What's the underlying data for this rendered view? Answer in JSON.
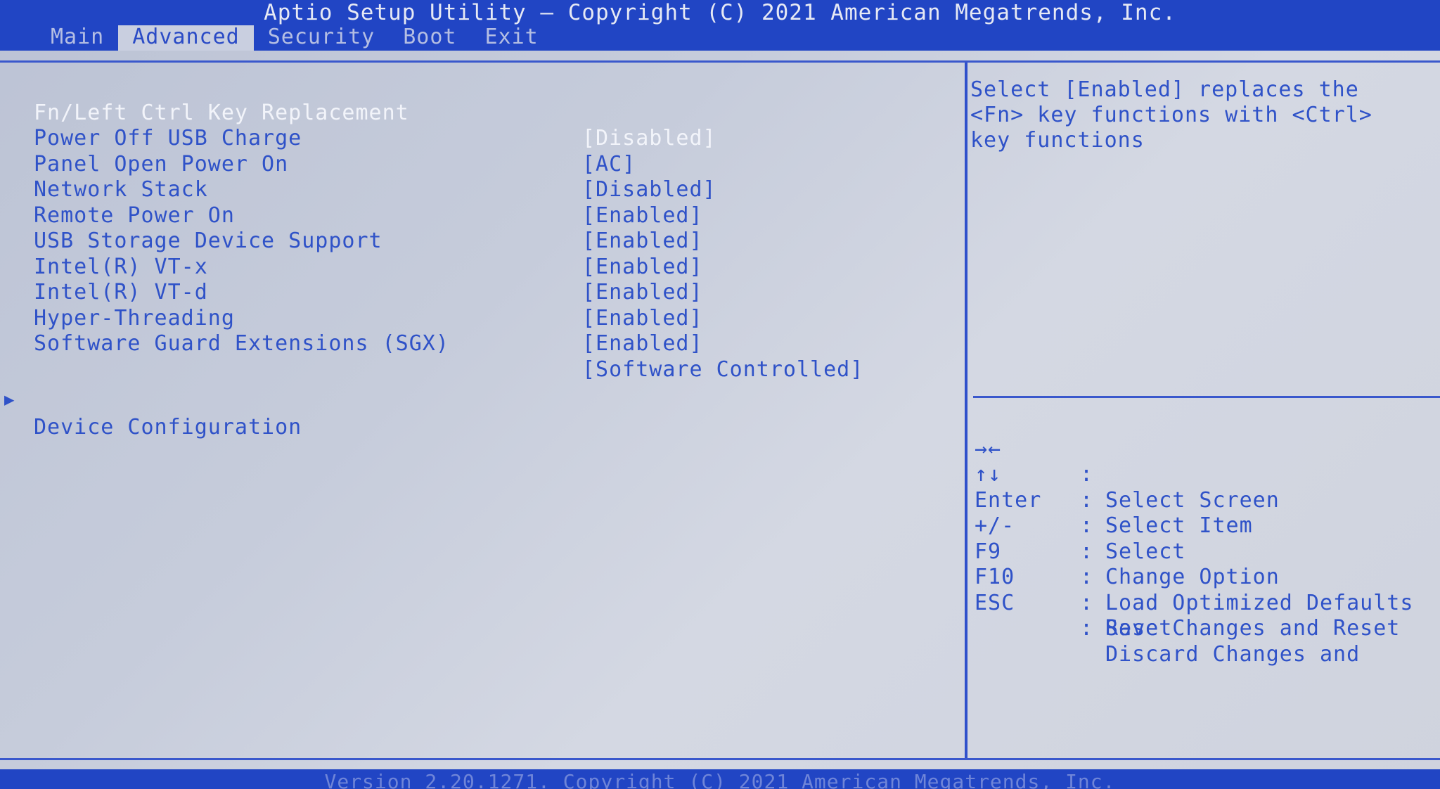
{
  "header": {
    "title": "Aptio Setup Utility – Copyright (C) 2021 American Megatrends, Inc.",
    "tabs": [
      {
        "label": "Main"
      },
      {
        "label": "Advanced"
      },
      {
        "label": "Security"
      },
      {
        "label": "Boot"
      },
      {
        "label": "Exit"
      }
    ],
    "active_tab": "Advanced"
  },
  "settings": [
    {
      "label": "Fn/Left Ctrl Key Replacement",
      "value": "[Disabled]"
    },
    {
      "label": "Power Off USB Charge",
      "value": "[AC]"
    },
    {
      "label": "Panel Open Power On",
      "value": "[Disabled]"
    },
    {
      "label": "Network Stack",
      "value": "[Enabled]"
    },
    {
      "label": "Remote Power On",
      "value": "[Enabled]"
    },
    {
      "label": "USB Storage Device Support",
      "value": "[Enabled]"
    },
    {
      "label": "Intel(R) VT-x",
      "value": "[Enabled]"
    },
    {
      "label": "Intel(R) VT-d",
      "value": "[Enabled]"
    },
    {
      "label": "Hyper-Threading",
      "value": "[Enabled]"
    },
    {
      "label": "Software Guard Extensions (SGX)",
      "value": "[Software Controlled]"
    }
  ],
  "selected_setting": "Fn/Left Ctrl Key Replacement",
  "submenu": {
    "arrow": "▶",
    "label": "Device Configuration"
  },
  "help": {
    "lines": [
      "Select [Enabled] replaces the",
      "<Fn> key functions with <Ctrl>",
      "key functions"
    ]
  },
  "keys": [
    {
      "key": "→←",
      "desc": "Select Screen"
    },
    {
      "key": "↑↓",
      "desc": "Select Item"
    },
    {
      "key": "Enter",
      "desc": "Select"
    },
    {
      "key": "+/-",
      "desc": "Change Option"
    },
    {
      "key": "F9",
      "desc": "Load Optimized Defaults"
    },
    {
      "key": "F10",
      "desc": "Save Changes and Reset"
    },
    {
      "key": "ESC",
      "desc": "Discard Changes and",
      "desc2": "Reset"
    }
  ],
  "key_separator": ":",
  "footer": {
    "text": "Version 2.20.1271. Copyright (C) 2021 American Megatrends, Inc."
  },
  "colors": {
    "header_bg": "#2145c4",
    "screen_bg": "#c6ccdb",
    "text_blue": "#2f52c8",
    "selected_text": "#f2f4fa",
    "tab_inactive": "#b4bee3"
  }
}
